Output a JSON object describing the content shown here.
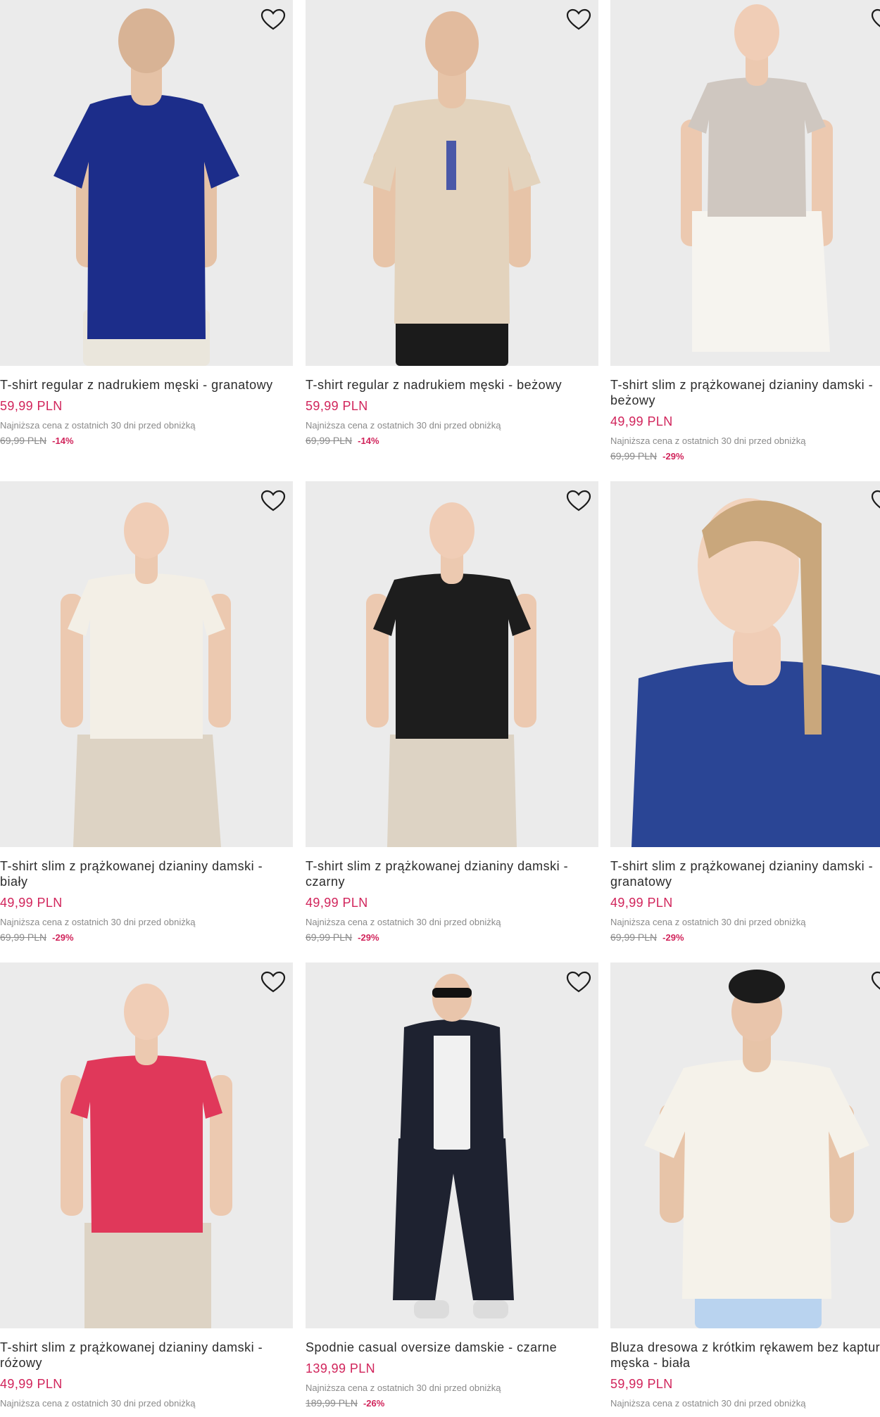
{
  "colors": {
    "price": "#d1245b",
    "muted": "#8a8a8a",
    "image_bg": "#ebebeb"
  },
  "products": [
    {
      "title": "T-shirt regular z nadrukiem męski - granatowy",
      "price": "59,99 PLN",
      "lowest_note": "Najniższa cena z ostatnich 30 dni przed obniżką",
      "old_price": "69,99 PLN",
      "discount": "-14%",
      "shirt_color": "#1c2d8a",
      "pants_color": "#eae6dc"
    },
    {
      "title": "T-shirt regular z nadrukiem męski - beżowy",
      "price": "59,99 PLN",
      "lowest_note": "Najniższa cena z ostatnich 30 dni przed obniżką",
      "old_price": "69,99 PLN",
      "discount": "-14%",
      "shirt_color": "#e3d3bd",
      "pants_color": "#1b1b1b"
    },
    {
      "title": "T-shirt slim z prążkowanej dzianiny damski - beżowy",
      "price": "49,99 PLN",
      "lowest_note": "Najniższa cena z ostatnich 30 dni przed obniżką",
      "old_price": "69,99 PLN",
      "discount": "-29%",
      "shirt_color": "#cfc7c0",
      "pants_color": "#f6f4ef"
    },
    {
      "title": "T-shirt slim z prążkowanej dzianiny damski - biały",
      "price": "49,99 PLN",
      "lowest_note": "Najniższa cena z ostatnich 30 dni przed obniżką",
      "old_price": "69,99 PLN",
      "discount": "-29%",
      "shirt_color": "#f3efe6",
      "pants_color": "#ddd3c4"
    },
    {
      "title": "T-shirt slim z prążkowanej dzianiny damski - czarny",
      "price": "49,99 PLN",
      "lowest_note": "Najniższa cena z ostatnich 30 dni przed obniżką",
      "old_price": "69,99 PLN",
      "discount": "-29%",
      "shirt_color": "#1d1d1d",
      "pants_color": "#ddd3c4"
    },
    {
      "title": "T-shirt slim z prążkowanej dzianiny damski - granatowy",
      "price": "49,99 PLN",
      "lowest_note": "Najniższa cena z ostatnich 30 dni przed obniżką",
      "old_price": "69,99 PLN",
      "discount": "-29%",
      "shirt_color": "#2a4595",
      "pants_color": "#2a4595"
    },
    {
      "title": "T-shirt slim z prążkowanej dzianiny damski - różowy",
      "price": "49,99 PLN",
      "lowest_note": "Najniższa cena z ostatnich 30 dni przed obniżką",
      "old_price": "",
      "discount": "",
      "shirt_color": "#e0385a",
      "pants_color": "#ddd3c4"
    },
    {
      "title": "Spodnie casual oversize damskie - czarne",
      "price": "139,99 PLN",
      "lowest_note": "Najniższa cena z ostatnich 30 dni przed obniżką",
      "old_price": "189,99 PLN",
      "discount": "-26%",
      "shirt_color": "#1e2230",
      "pants_color": "#1e2230"
    },
    {
      "title": "Bluza dresowa z krótkim rękawem bez kaptura męska - biała",
      "price": "59,99 PLN",
      "lowest_note": "Najniższa cena z ostatnich 30 dni przed obniżką",
      "old_price": "",
      "discount": "",
      "shirt_color": "#f5f2ea",
      "pants_color": "#b9d3ef"
    }
  ]
}
